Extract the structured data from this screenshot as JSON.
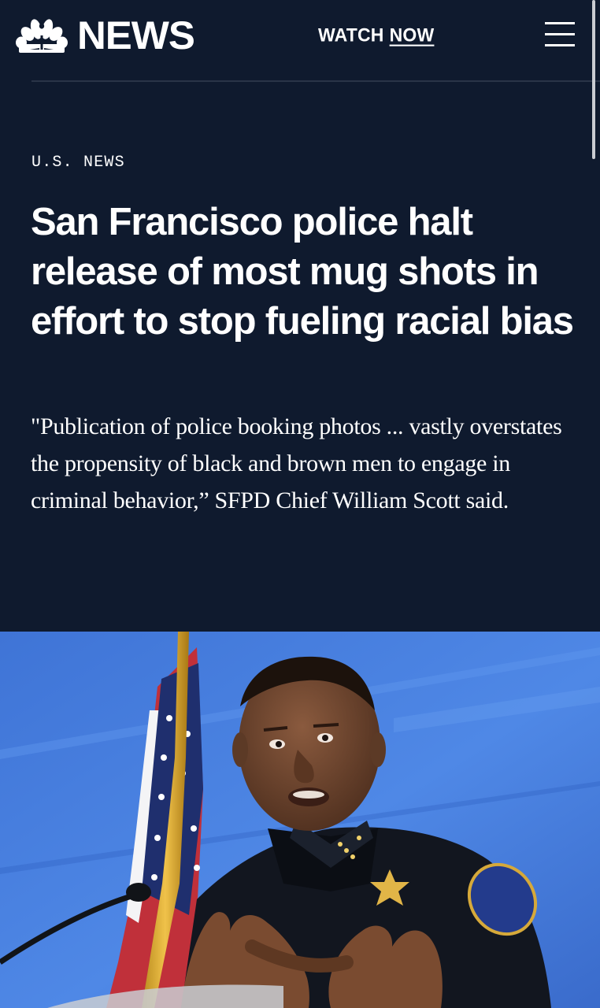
{
  "header": {
    "logo_text": "NEWS",
    "watch_label": "WATCH",
    "now_label": "NOW"
  },
  "article": {
    "section": "U.S. NEWS",
    "headline": "San Francisco police halt release of most mug shots in effort to stop fueling racial bias",
    "dek": "\"Publication of police booking photos ... vastly overstates the propensity of black and brown men to engage in criminal behavior,” SFPD Chief William Scott said."
  },
  "colors": {
    "background": "#0f1a2e",
    "text": "#ffffff",
    "photo_backdrop": "#4a7fe0"
  },
  "icons": {
    "logo": "nbc-peacock-icon",
    "menu": "hamburger-menu-icon"
  }
}
